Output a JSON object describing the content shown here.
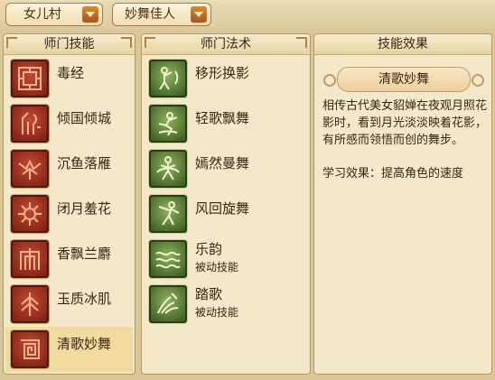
{
  "filters": {
    "school": "女儿村",
    "branch": "妙舞佳人"
  },
  "panels": {
    "school_skills": {
      "header": "师门技能",
      "items": [
        {
          "name": "毒经",
          "icon": "maze-seal-icon"
        },
        {
          "name": "倾国倾城",
          "icon": "figure-seal-icon"
        },
        {
          "name": "沉鱼落雁",
          "icon": "bird-seal-icon"
        },
        {
          "name": "闭月羞花",
          "icon": "sun-seal-icon"
        },
        {
          "name": "香飘兰麝",
          "icon": "incense-seal-icon"
        },
        {
          "name": "玉质冰肌",
          "icon": "feather-seal-icon"
        },
        {
          "name": "清歌妙舞",
          "icon": "swirl-seal-icon",
          "selected": true
        }
      ]
    },
    "school_spells": {
      "header": "师门法术",
      "items": [
        {
          "name": "移形换影",
          "sub": "",
          "icon": "dancer-shadow-icon"
        },
        {
          "name": "轻歌飘舞",
          "sub": "",
          "icon": "flying-dancer-icon"
        },
        {
          "name": "嫣然曼舞",
          "sub": "",
          "icon": "twirl-dancer-icon"
        },
        {
          "name": "风回旋舞",
          "sub": "",
          "icon": "wind-dancer-icon"
        },
        {
          "name": "乐韵",
          "sub": "被动技能",
          "icon": "music-wave-icon"
        },
        {
          "name": "踏歌",
          "sub": "被动技能",
          "icon": "dance-step-icon"
        }
      ]
    },
    "skill_effect": {
      "header": "技能效果",
      "title": "清歌妙舞",
      "description": "相传古代美女貂婵在夜观月照花影时，看到月光淡淡映着花影，有所感而领悟而创的舞步。",
      "effect": "学习效果：提高角色的速度"
    }
  },
  "colors": {
    "background": "#d9c79a",
    "panel": "#f3e8c9",
    "selected_row": "#f0dc9e",
    "text": "#3b2510",
    "red_icon": "#a3321f",
    "green_icon": "#5d8a36",
    "dropdown_arrow": "#c4742a"
  }
}
